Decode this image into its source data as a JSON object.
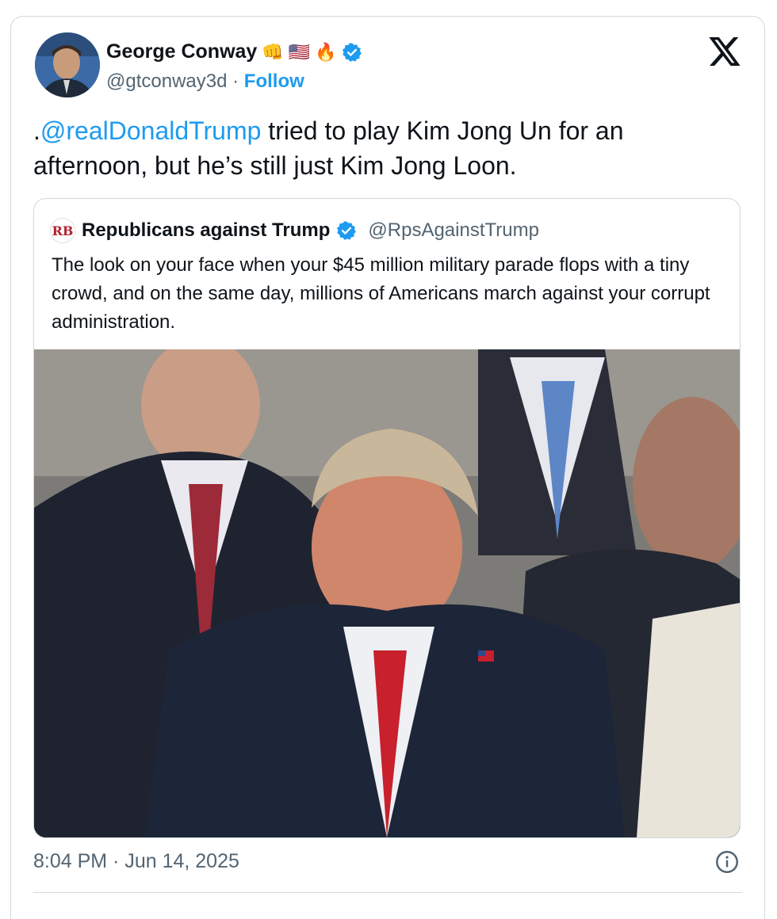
{
  "author": {
    "display_name": "George Conway",
    "emoji_badges": [
      "👊",
      "🇺🇸",
      "🔥"
    ],
    "handle": "@gtconway3d",
    "separator": "·",
    "follow_label": "Follow",
    "verified": true
  },
  "tweet": {
    "text_prefix": ".",
    "mention": "@realDonaldTrump",
    "text_rest": " tried to play Kim Jong Un for an afternoon, but he’s still just Kim Jong Loon."
  },
  "quote": {
    "avatar_text": "RB",
    "display_name": "Republicans against Trump",
    "verified": true,
    "handle": "@RpsAgainstTrump",
    "text": "The look on your face when your $45 million military parade flops with a tiny crowd, and on the same day, millions of Americans march against your corrupt administration."
  },
  "footer": {
    "timestamp": "8:04 PM · Jun 14, 2025"
  },
  "icons": {
    "close": "x-logo-icon",
    "verified": "verified-badge-icon",
    "info": "info-icon"
  },
  "colors": {
    "link": "#1d9bf0",
    "secondary_text": "#536471",
    "border": "#cfd9de"
  }
}
